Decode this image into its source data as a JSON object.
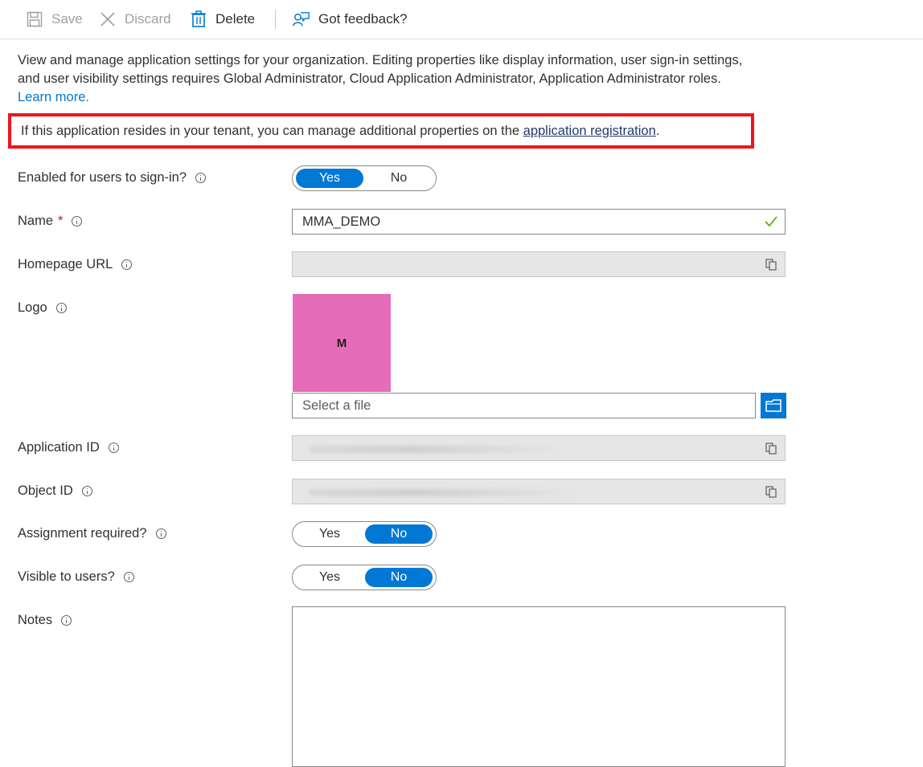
{
  "toolbar": {
    "save_label": "Save",
    "discard_label": "Discard",
    "delete_label": "Delete",
    "feedback_label": "Got feedback?"
  },
  "description": {
    "text": "View and manage application settings for your organization. Editing properties like display information, user sign-in settings, and user visibility settings requires Global Administrator, Cloud Application Administrator, Application Administrator roles.",
    "learn_more": "Learn more."
  },
  "notice": {
    "text": "If this application resides in your tenant, you can manage additional properties on the",
    "link": "application registration",
    "suffix": "."
  },
  "form": {
    "enabled": {
      "label": "Enabled for users to sign-in?",
      "yes": "Yes",
      "no": "No",
      "selected": "Yes"
    },
    "name": {
      "label": "Name",
      "required_mark": "*",
      "value": "MMA_DEMO"
    },
    "homepage": {
      "label": "Homepage URL",
      "value": ""
    },
    "logo": {
      "label": "Logo",
      "letter": "M",
      "file_placeholder": "Select a file"
    },
    "application_id": {
      "label": "Application ID"
    },
    "object_id": {
      "label": "Object ID"
    },
    "assignment": {
      "label": "Assignment required?",
      "yes": "Yes",
      "no": "No",
      "selected": "No"
    },
    "visible": {
      "label": "Visible to users?",
      "yes": "Yes",
      "no": "No",
      "selected": "No"
    },
    "notes": {
      "label": "Notes",
      "value": ""
    }
  },
  "colors": {
    "accent": "#0078d4",
    "highlight_border": "#f0141e",
    "logo_background": "#e56cb9",
    "valid_check": "#57a300"
  }
}
